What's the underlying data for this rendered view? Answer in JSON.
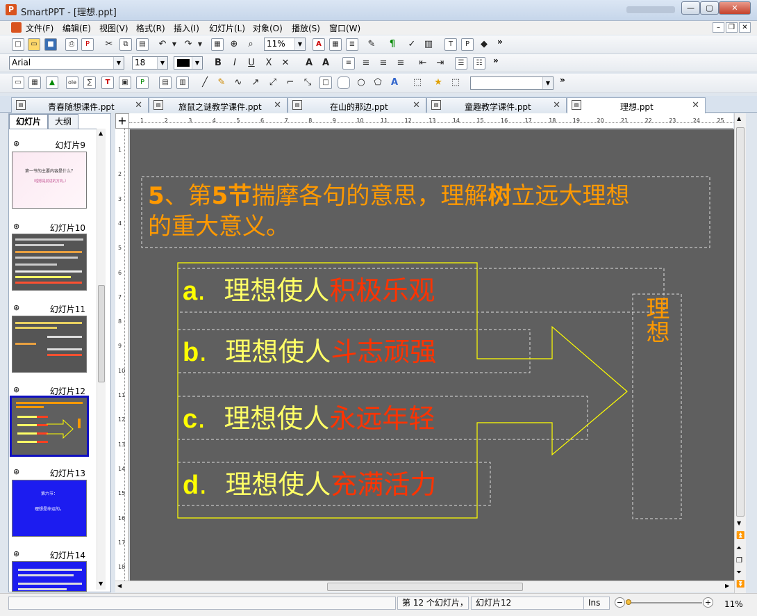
{
  "window": {
    "app_name": "SmartPPT - [理想.ppt]",
    "logo": "P",
    "min": "—",
    "max": "▢",
    "close": "✕"
  },
  "menu": [
    "文件(F)",
    "编辑(E)",
    "视图(V)",
    "格式(R)",
    "插入(I)",
    "幻灯片(L)",
    "对象(O)",
    "播放(S)",
    "窗口(W)"
  ],
  "toolbar1": {
    "zoom": "11%",
    "more": "»"
  },
  "toolbar2": {
    "font": "Arial",
    "size": "18",
    "more": "»"
  },
  "toolbar3": {
    "more": "»"
  },
  "tabs": [
    "青春随想课件.ppt",
    "旅鼠之谜教学课件.ppt",
    "在山的那边.ppt",
    "童趣教学课件.ppt",
    "理想.ppt"
  ],
  "panel_tabs": [
    "幻灯片",
    "大纲"
  ],
  "thumbnails": [
    {
      "label": "幻灯片9",
      "line1": "第一节的主要内容是什么？",
      "line2": "（理想是前进的方向。）"
    },
    {
      "label": "幻灯片10"
    },
    {
      "label": "幻灯片11"
    },
    {
      "label": "幻灯片12"
    },
    {
      "label": "幻灯片13",
      "line1": "第六节：",
      "line2": "理想是命运的。"
    },
    {
      "label": "幻灯片14"
    }
  ],
  "ruler": {
    "h": [
      "1",
      "2",
      "3",
      "4",
      "5",
      "6",
      "7",
      "8",
      "9",
      "10",
      "11",
      "12",
      "13",
      "14",
      "15",
      "16",
      "17",
      "18",
      "19",
      "20",
      "21",
      "22",
      "23",
      "24",
      "25"
    ],
    "v": [
      "1",
      "2",
      "3",
      "4",
      "5",
      "6",
      "7",
      "8",
      "9",
      "10",
      "11",
      "12",
      "13",
      "14",
      "15",
      "16",
      "17",
      "18"
    ]
  },
  "slide": {
    "title_num": "5",
    "title_a": "、第",
    "title_b": "5",
    "title_c": "节",
    "title_d": "揣摩各句的意思，理解",
    "title_e": "树",
    "title_f": "立远大理想",
    "title_line2": "的重大意义。",
    "items": [
      {
        "letter": "a",
        "dot": ".",
        "prefix": "理想使人",
        "emph": "积极乐观"
      },
      {
        "letter": "b",
        "dot": ".",
        "prefix": "理想使人",
        "emph": "斗志顽强"
      },
      {
        "letter": "c",
        "dot": ".",
        "prefix": "理想使人",
        "emph": "永远年轻"
      },
      {
        "letter": "d",
        "dot": ".",
        "prefix": "理想使人",
        "emph": "充满活力"
      }
    ],
    "side_text": "理想"
  },
  "status": {
    "slide_count": "第 12 个幻灯片，",
    "slide_name": "幻灯片12",
    "mode": "Ins",
    "zoom": "11%"
  },
  "colors": {
    "slide_bg": "#5f5f5f",
    "yellow": "#ffff00",
    "orange": "#ff9900",
    "red": "#ff3300",
    "slide13_bg": "#1c1cf0"
  }
}
